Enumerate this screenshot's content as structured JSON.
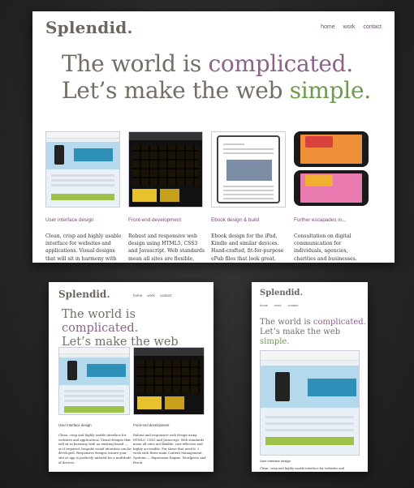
{
  "site": {
    "logo": "Splendid",
    "logo_dot": ".",
    "nav": [
      "home",
      "work",
      "contact"
    ],
    "hero": {
      "line1_prefix": "The world is ",
      "line1_highlight": "complicated.",
      "line2_prefix": "Let’s make the web ",
      "line2_highlight": "simple.",
      "highlight_colors": {
        "complicated": "#8b6389",
        "simple": "#6e9a4d"
      }
    }
  },
  "desktop": {
    "columns": [
      {
        "title": "User interface design",
        "thumb_icon": "website-mockup-thumbnail",
        "body": "Clean, crisp and highly usable interface for websites and applications. Visual designs that will sit in harmony with an existing"
      },
      {
        "title": "Front-end development",
        "thumb_icon": "dark-grid-website-thumbnail",
        "body": "Robust and responsive web design using HTML5, CSS3 and Javascript. Web standards mean all sites are flexible, cost-effective"
      },
      {
        "title": "Ebook design & build",
        "thumb_icon": "ebook-tablet-thumbnail",
        "body": "Ebook design for the iPad, Kindle and similar devices. Hand-crafted, fit-for-purpose ePub files that look great, work perfectly across many"
      },
      {
        "title": "Further escapades in...",
        "thumb_icon": "phone-app-thumbnail",
        "body": "Consultation on digital communication for individuals, agencies, charities and businesses. Video production,"
      }
    ]
  },
  "tablet": {
    "columns": [
      {
        "title": "User interface design",
        "body": "Clean, crisp and highly usable interface for websites and applications. Visual designs that will sit in harmony with an existing brand — or if required, bespoke visual identities can be developed. Responsive designs ensure your site or app is perfectly tailored for a multitude of devices."
      },
      {
        "title": "Front-end development",
        "body": "Robust and responsive web design using HTML5, CSS3 and Javascript. Web standards mean all sites are flexible, cost-effective and highly accessible. For those that need it, I work with three main Content Management Systems — Expression Engine, Wordpress and Perch."
      }
    ]
  },
  "mobile": {
    "column": {
      "title": "User interface design",
      "body": "Clean, crisp and highly usable interface for websites and"
    }
  },
  "colors": {
    "accent_purple": "#8b6389",
    "accent_green": "#6e9a4d",
    "text_grey": "#756e66",
    "background": "#262626"
  }
}
